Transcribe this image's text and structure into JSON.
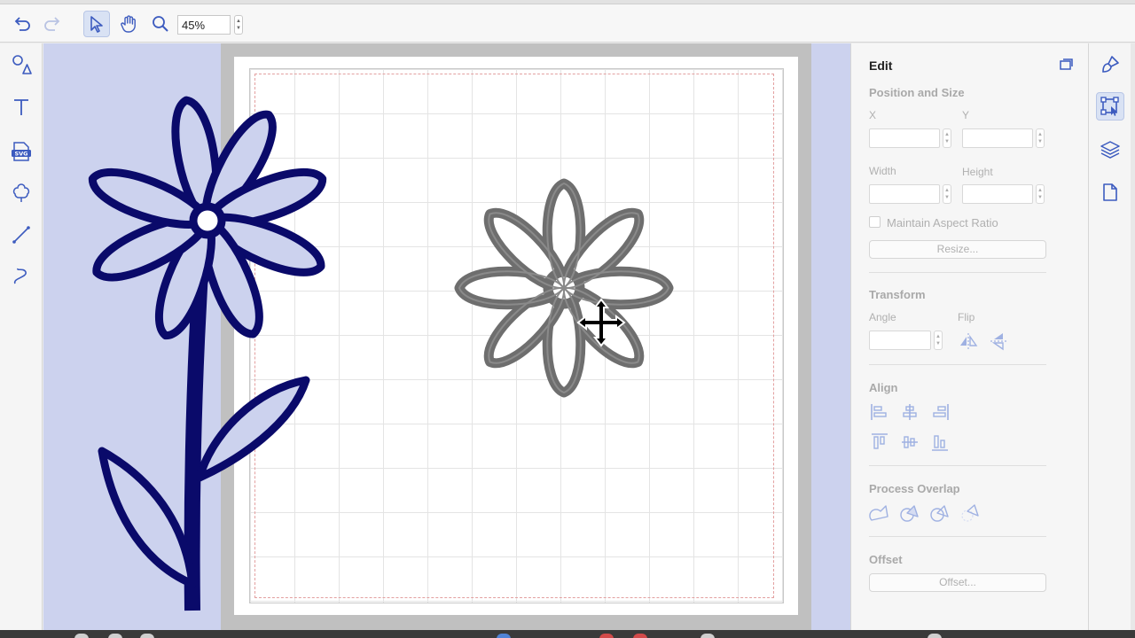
{
  "toolbar": {
    "zoom_value": "45%",
    "icons": [
      "undo-icon",
      "redo-icon",
      "select-arrow-icon",
      "hand-pan-icon",
      "zoom-magnifier-icon"
    ]
  },
  "left_tools": [
    "shapes-icon",
    "text-icon",
    "svg-import-icon",
    "trace-icon",
    "line-icon",
    "freehand-icon"
  ],
  "edit_panel": {
    "title": "Edit",
    "position_size": {
      "title": "Position and Size",
      "x_label": "X",
      "y_label": "Y",
      "width_label": "Width",
      "height_label": "Height",
      "maintain_aspect": "Maintain Aspect Ratio",
      "resize_button": "Resize..."
    },
    "transform": {
      "title": "Transform",
      "angle_label": "Angle",
      "flip_label": "Flip"
    },
    "align": {
      "title": "Align"
    },
    "process_overlap": {
      "title": "Process Overlap"
    },
    "offset": {
      "title": "Offset",
      "button": "Offset..."
    }
  },
  "right_strip": [
    "paintbrush-icon",
    "transform-select-icon",
    "layers-icon",
    "document-icon"
  ],
  "colors": {
    "accent": "#3c5bbf",
    "canvas_bg": "#ccd2ee",
    "flower_stroke": "#0a0a6a",
    "flower_gray": "#6e6e6e"
  }
}
